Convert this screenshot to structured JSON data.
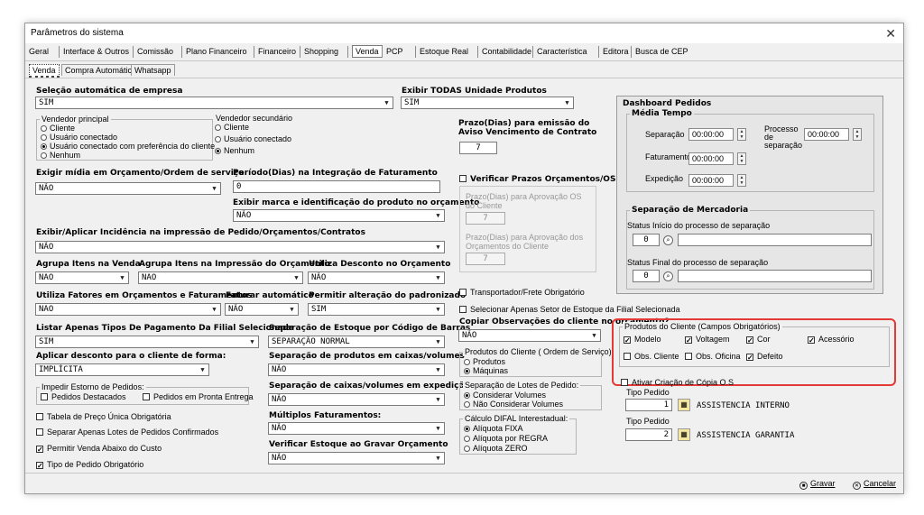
{
  "window": {
    "title": "Parâmetros do sistema"
  },
  "tabs": [
    "Geral",
    "Interface & Outros",
    "Comissão",
    "Plano Financeiro",
    "Financeiro",
    "Shopping",
    "Venda",
    "PCP",
    "Estoque Real",
    "Contabilidade",
    "Característica",
    "Editora",
    "Busca de CEP"
  ],
  "active_tab": "Venda",
  "subtabs": [
    "Venda",
    "Compra Automática",
    "Whatsapp"
  ],
  "left": {
    "selecao_label": "Seleção automática de empresa",
    "selecao_value": "SIM",
    "vendedor_principal": {
      "title": "Vendedor principal",
      "options": [
        "Cliente",
        "Usuário conectado",
        "Usuário conectado com preferência do cliente",
        "Nenhum"
      ],
      "selected": "Usuário conectado com preferência do cliente"
    },
    "vendedor_secundario": {
      "title": "Vendedor secundário",
      "options": [
        "Cliente",
        "Usuário conectado",
        "Nenhum"
      ],
      "selected": "Nenhum"
    },
    "exigir_media_label": "Exigir mídia em Orçamento/Ordem de serviço",
    "exigir_media_value": "NÃO",
    "periodo_label": "Período(Dias) na Integração de Faturamento",
    "periodo_value": "0",
    "exibir_marca_label": "Exibir marca e identificação do produto no orçamento",
    "exibir_marca_value": "NÃO",
    "incidencia_label": "Exibir/Aplicar Incidência na impressão de Pedido/Orçamentos/Contratos",
    "incidencia_value": "NÃO",
    "agrupa_venda_label": "Agrupa Itens na Venda",
    "agrupa_venda_value": "NAO",
    "agrupa_impressao_label": "Agrupa Itens na Impressão do Orçamento",
    "agrupa_impressao_value": "NAO",
    "desconto_orc_label": "Utiliza Desconto no Orçamento",
    "desconto_orc_value": "NÃO",
    "fatores_label": "Utiliza Fatores em Orçamentos e Faturamentos",
    "fatores_value": "NAO",
    "faturar_auto_label": "Faturar automático",
    "faturar_auto_value": "NÃO",
    "padronizado_label": "Permitir alteração do padronizado",
    "padronizado_value": "SIM",
    "listar_tipos_label": "Listar Apenas Tipos De Pagamento Da Filial Selecionada",
    "listar_tipos_value": "SIM",
    "separacao_codigo_label": "Separação de Estoque por Código de Barras",
    "separacao_codigo_value": "SEPARAÇÃO NORMAL",
    "aplicar_desconto_label": "Aplicar desconto para o cliente de forma:",
    "aplicar_desconto_value": "IMPLÍCITA",
    "sep_produtos_label": "Separação de produtos em caixas/volumes",
    "sep_produtos_value": "NÃO",
    "impedir_estorno": {
      "title": "Impedir Estorno de Pedidos:",
      "options": [
        "Pedidos Destacados",
        "Pedidos em Pronta Entrega"
      ]
    },
    "sep_caixas_label": "Separação de caixas/volumes em expedição",
    "sep_caixas_value": "NÃO",
    "multiplos_label": "Múltiplos Faturamentos:",
    "multiplos_value": "NÃO",
    "verificar_estoque_label": "Verificar Estoque ao Gravar Orçamento",
    "verificar_estoque_value": "NÃO",
    "checks": [
      {
        "label": "Tabela de Preço Única Obrigatória",
        "checked": false
      },
      {
        "label": "Separar Apenas Lotes de Pedidos Confirmados",
        "checked": false
      },
      {
        "label": "Permitir Venda Abaixo do Custo",
        "checked": true
      },
      {
        "label": "Tipo de Pedido Obrigatório",
        "checked": true
      }
    ]
  },
  "middle": {
    "exibir_todas_label": "Exibir TODAS Unidade Produtos",
    "exibir_todas_value": "SIM",
    "prazo_label": "Prazo(Dias) para emissão do Aviso Vencimento de Contrato",
    "prazo_value": "7",
    "verificar_prazos_label": "Verificar Prazos Orçamentos/OS",
    "prazo_os_label": "Prazo(Dias) para Aprovação OS do Cliente",
    "prazo_os_value": "7",
    "prazo_orc_label": "Prazo(Dias) para Aprovação dos Orçamentos do Cliente",
    "prazo_orc_value": "7",
    "transportador_label": "Transportador/Frete Obrigatório",
    "setor_label": "Selecionar Apenas Setor de Estoque da Filial Selecionada",
    "copiar_obs_label": "Copiar Observações do cliente no orçamento?",
    "copiar_obs_value": "NÃO",
    "produtos_cliente_os": {
      "title": "Produtos do Cliente ( Ordem de Serviço)",
      "options": [
        "Produtos",
        "Máquinas"
      ],
      "selected": "Máquinas"
    },
    "sep_lotes": {
      "title": "Separação de Lotes de Pedido:",
      "options": [
        "Considerar Volumes",
        "Não Considerar Volumes"
      ],
      "selected": "Considerar Volumes"
    },
    "difal": {
      "title": "Cálculo DIFAL Interestadual:",
      "options": [
        "Alíquota FIXA",
        "Alíquota por REGRA",
        "Alíquota ZERO"
      ],
      "selected": "Alíquota FIXA"
    }
  },
  "dashboard": {
    "title": "Dashboard Pedidos",
    "media_tempo": "Média Tempo",
    "separacao": "Separação",
    "separacao_value": "00:00:00",
    "processo_sep": "Processo de separação",
    "processo_sep_value": "00:00:00",
    "faturamento": "Faturamento",
    "faturamento_value": "00:00:00",
    "expedicao": "Expedição",
    "expedicao_value": "00:00:00",
    "sep_mercadoria": "Separação de Mercadoria",
    "status_inicio": "Status Início do processo de separação",
    "status_inicio_value": "0",
    "status_final": "Status Final do processo de separação",
    "status_final_value": "0"
  },
  "produtos_cliente": {
    "title": "Produtos do Cliente (Campos Obrigatórios)",
    "row1": [
      {
        "label": "Modelo",
        "checked": true
      },
      {
        "label": "Voltagem",
        "checked": true
      },
      {
        "label": "Cor",
        "checked": true
      },
      {
        "label": "Acessório",
        "checked": true
      }
    ],
    "row2": [
      {
        "label": "Obs. Cliente",
        "checked": false
      },
      {
        "label": "Obs. Oficina",
        "checked": false
      },
      {
        "label": "Defeito",
        "checked": true
      }
    ]
  },
  "copia_os": {
    "label": "Ativar Criação de Cópia O.S",
    "tipo1_label": "Tipo Pedido",
    "tipo1_value": "1",
    "tipo1_desc": "ASSISTENCIA INTERNO",
    "tipo2_label": "Tipo Pedido",
    "tipo2_value": "2",
    "tipo2_desc": "ASSISTENCIA GARANTIA"
  },
  "footer": {
    "gravar": "Gravar",
    "cancelar": "Cancelar"
  },
  "colors": {
    "highlight": "#e53935",
    "window_bg": "#f0f0f0"
  }
}
